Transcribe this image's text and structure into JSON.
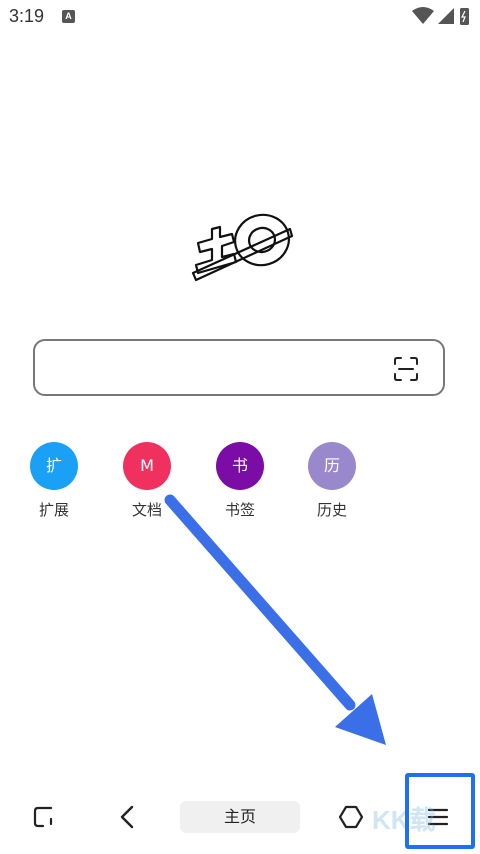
{
  "status": {
    "time": "3:19",
    "notification_icon": "A"
  },
  "search": {
    "placeholder": ""
  },
  "quick_links": [
    {
      "glyph": "扩",
      "label": "扩展",
      "color": "#1aa1f5"
    },
    {
      "glyph": "M",
      "label": "文档",
      "color": "#f0305f"
    },
    {
      "glyph": "书",
      "label": "书签",
      "color": "#7b0da6"
    },
    {
      "glyph": "历",
      "label": "历史",
      "color": "#9a88cc"
    }
  ],
  "bottom_nav": {
    "home_label": "主页",
    "icons": [
      "tabs-icon",
      "back-icon",
      "hexagon-icon",
      "menu-icon"
    ]
  },
  "watermark": "KK载",
  "colors": {
    "annotation_blue": "#1e6ff5",
    "arrow_blue": "#3a6fe8"
  }
}
